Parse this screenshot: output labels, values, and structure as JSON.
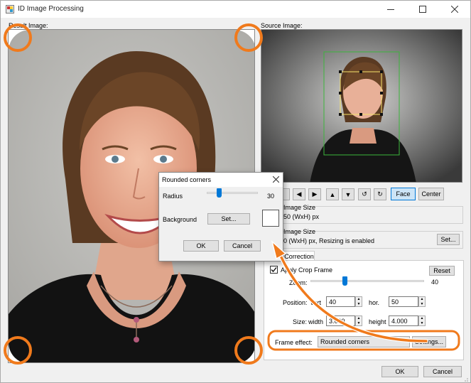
{
  "window": {
    "title": "ID Image Processing",
    "minimize_icon": "minimize-icon",
    "maximize_icon": "maximize-icon",
    "close_icon": "close-icon"
  },
  "labels": {
    "result_image": "Result Image:",
    "source_image": "Source Image:"
  },
  "nav_buttons": {
    "left": "◀",
    "right": "▶",
    "up": "▲",
    "down": "▼",
    "rotate_left": "↺",
    "rotate_right": "↻",
    "face": "Face",
    "center": "Center"
  },
  "source_image_size": {
    "title": "Image Size",
    "value": "50 (WxH) px"
  },
  "result_image_size": {
    "title": "Image Size",
    "value": "0 (WxH) px, Resizing is enabled",
    "settings_button": "Set..."
  },
  "tab": {
    "label": "Correction"
  },
  "crop": {
    "checkbox_label": "Apply Crop Frame",
    "checked": true,
    "reset_button": "Reset",
    "zoom_label": "Zoom:",
    "zoom_value": "40",
    "zoom_level": 0.3,
    "position_label": "Position:",
    "vert_label": "vert",
    "vert_value": "40",
    "hor_label": "hor.",
    "hor_value": "50",
    "size_label": "Size:",
    "width_label": "width",
    "width_value": "3.000",
    "height_label": "height",
    "height_value": "4.000"
  },
  "frame_effect": {
    "label": "Frame effect:",
    "value": "Rounded corners",
    "settings_button": "Settings..."
  },
  "footer": {
    "ok": "OK",
    "cancel": "Cancel"
  },
  "dialog": {
    "title": "Rounded corners",
    "close_icon": "close-icon",
    "radius_label": "Radius",
    "radius_value": "30",
    "radius_level": 0.24,
    "background_label": "Background",
    "set_button": "Set...",
    "ok": "OK",
    "cancel": "Cancel"
  },
  "colors": {
    "highlight_orange": "#f07a1c",
    "accent_blue": "#0078d7",
    "face_box": "#f5e26b",
    "crop_box": "#3cb53c"
  }
}
